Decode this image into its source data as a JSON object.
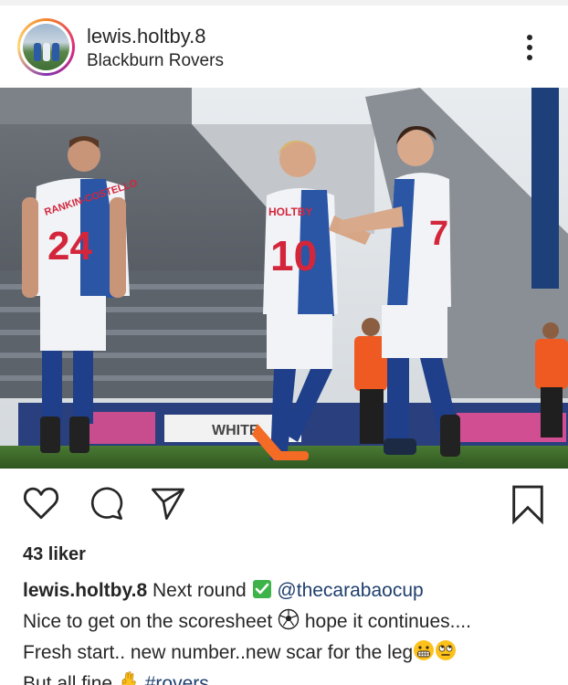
{
  "post": {
    "username": "lewis.holtby.8",
    "location": "Blackburn Rovers",
    "likes": "43 liker",
    "caption": {
      "username": "lewis.holtby.8",
      "line1_text": "Next round",
      "mention": "@thecarabaocup",
      "line2_text": "Nice to get on the scoresheet",
      "line2_after": "hope it continues....",
      "line3_text": "Fresh start.. new number..new scar for the leg",
      "line4_text": "But all fine",
      "hashtag": "#rovers"
    }
  },
  "photo": {
    "shirt_left": "24",
    "shirt_center": "10",
    "shirt_right": "7",
    "back_name_left": "RANKIN-COSTELLO",
    "back_name_center": "HOLTBY",
    "board_text": "WHITE"
  },
  "icons": {
    "more": "more-options-icon",
    "like": "heart-icon",
    "comment": "comment-icon",
    "share": "send-icon",
    "save": "bookmark-icon",
    "check": "check-mark-emoji",
    "ball": "soccer-ball-emoji",
    "grimace": "grimacing-face-emoji",
    "eyeroll": "eye-roll-emoji",
    "ok": "ok-hand-emoji"
  },
  "colors": {
    "rovers_blue": "#2a56a5",
    "link": "#1f3f6e",
    "pitch": "#3f6a2b",
    "accent_orange": "#ef5a22"
  }
}
